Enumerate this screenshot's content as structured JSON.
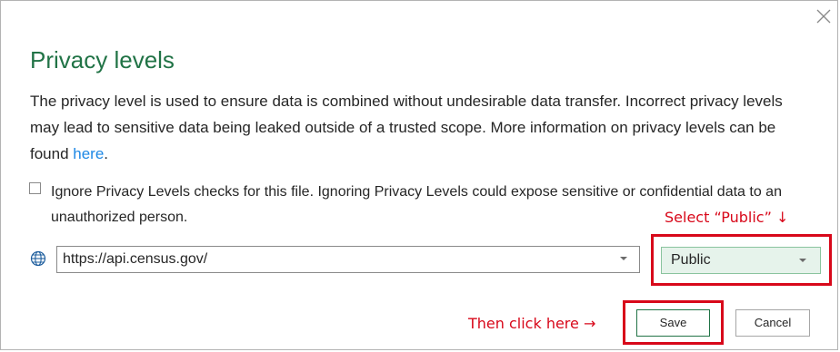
{
  "dialog": {
    "title": "Privacy levels",
    "description_text": "The privacy level is used to ensure data is combined without undesirable data transfer. Incorrect privacy levels may lead to sensitive data being leaked outside of a trusted scope. More information on privacy levels can be found ",
    "description_link": "here",
    "description_end": ".",
    "close_icon": "close-icon"
  },
  "ignore_checkbox": {
    "checked": false,
    "label": "Ignore Privacy Levels checks for this file. Ignoring Privacy Levels could expose sensitive or confidential data to an unauthorized person."
  },
  "source": {
    "icon": "globe-icon",
    "url": "https://api.census.gov/",
    "privacy_level": "Public"
  },
  "buttons": {
    "save": "Save",
    "cancel": "Cancel"
  },
  "annotations": {
    "select_public": "Select “Public” ↓",
    "then_click": "Then click here →",
    "highlight_color": "#d8081a"
  },
  "colors": {
    "title": "#217346",
    "link": "#1e88e5",
    "selected_level_bg": "#e6f3eb"
  }
}
